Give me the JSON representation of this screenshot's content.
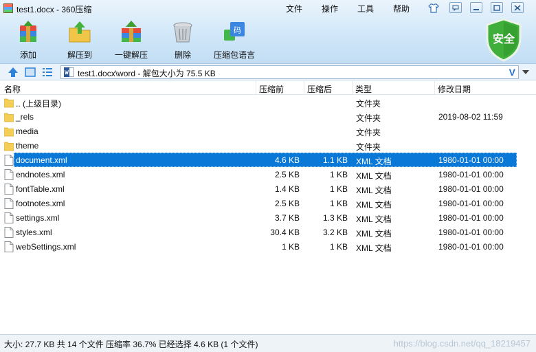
{
  "window": {
    "title": "test1.docx - 360压缩",
    "menu": [
      "文件",
      "操作",
      "工具",
      "帮助"
    ]
  },
  "toolbar": {
    "items": [
      {
        "label": "添加",
        "icon": "add-archive-icon"
      },
      {
        "label": "解压到",
        "icon": "extract-to-icon"
      },
      {
        "label": "一键解压",
        "icon": "one-click-extract-icon"
      },
      {
        "label": "删除",
        "icon": "trash-icon"
      },
      {
        "label": "压缩包语言",
        "icon": "archive-language-icon"
      }
    ],
    "language_badge": "码",
    "security_badge": "安全"
  },
  "address": {
    "path": "test1.docx\\word - 解包大小为 75.5 KB",
    "v_mark": "V"
  },
  "columns": {
    "name": "名称",
    "size": "压缩前",
    "packed": "压缩后",
    "type": "类型",
    "modified": "修改日期"
  },
  "files": [
    {
      "name": ".. (上级目录)",
      "size": "",
      "packed": "",
      "type": "文件夹",
      "modified": "",
      "kind": "folder",
      "selected": false
    },
    {
      "name": "_rels",
      "size": "",
      "packed": "",
      "type": "文件夹",
      "modified": "2019-08-02 11:59",
      "kind": "folder",
      "selected": false
    },
    {
      "name": "media",
      "size": "",
      "packed": "",
      "type": "文件夹",
      "modified": "",
      "kind": "folder",
      "selected": false
    },
    {
      "name": "theme",
      "size": "",
      "packed": "",
      "type": "文件夹",
      "modified": "",
      "kind": "folder",
      "selected": false
    },
    {
      "name": "document.xml",
      "size": "4.6 KB",
      "packed": "1.1 KB",
      "type": "XML 文档",
      "modified": "1980-01-01 00:00",
      "kind": "file",
      "selected": true
    },
    {
      "name": "endnotes.xml",
      "size": "2.5 KB",
      "packed": "1 KB",
      "type": "XML 文档",
      "modified": "1980-01-01 00:00",
      "kind": "file",
      "selected": false
    },
    {
      "name": "fontTable.xml",
      "size": "1.4 KB",
      "packed": "1 KB",
      "type": "XML 文档",
      "modified": "1980-01-01 00:00",
      "kind": "file",
      "selected": false
    },
    {
      "name": "footnotes.xml",
      "size": "2.5 KB",
      "packed": "1 KB",
      "type": "XML 文档",
      "modified": "1980-01-01 00:00",
      "kind": "file",
      "selected": false
    },
    {
      "name": "settings.xml",
      "size": "3.7 KB",
      "packed": "1.3 KB",
      "type": "XML 文档",
      "modified": "1980-01-01 00:00",
      "kind": "file",
      "selected": false
    },
    {
      "name": "styles.xml",
      "size": "30.4 KB",
      "packed": "3.2 KB",
      "type": "XML 文档",
      "modified": "1980-01-01 00:00",
      "kind": "file",
      "selected": false
    },
    {
      "name": "webSettings.xml",
      "size": "1 KB",
      "packed": "1 KB",
      "type": "XML 文档",
      "modified": "1980-01-01 00:00",
      "kind": "file",
      "selected": false
    }
  ],
  "status": {
    "text": "大小: 27.7 KB 共 14 个文件 压缩率 36.7% 已经选择 4.6 KB (1 个文件)",
    "watermark": "https://blog.csdn.net/qq_18219457"
  },
  "colors": {
    "selection": "#0a78d7",
    "folder": "#f4cf57",
    "shield": "#3fae3a"
  }
}
